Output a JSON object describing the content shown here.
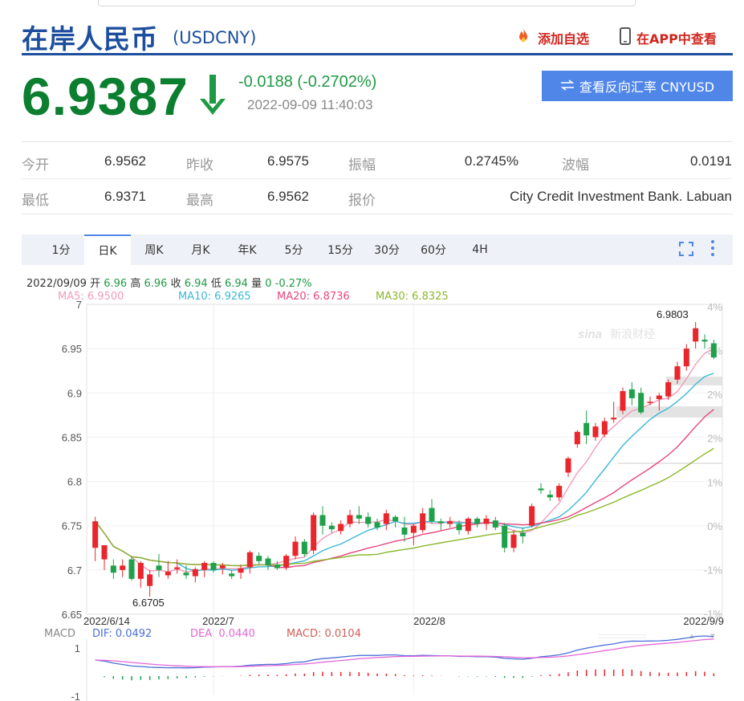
{
  "header": {
    "title": "在岸人民币",
    "code": "(USDCNY)",
    "add_watch": "添加自选",
    "view_app": "在APP中查看"
  },
  "quote": {
    "price": "6.9387",
    "change": "-0.0188 (-0.2702%)",
    "time": "2022-09-09 11:40:03",
    "reverse_button": "查看反向汇率 CNYUSD",
    "direction": "down"
  },
  "stats": [
    {
      "label": "今开",
      "value": "6.9562"
    },
    {
      "label": "昨收",
      "value": "6.9575"
    },
    {
      "label": "振幅",
      "value": "0.2745%"
    },
    {
      "label": "波幅",
      "value": "0.0191"
    },
    {
      "label": "最低",
      "value": "6.9371"
    },
    {
      "label": "最高",
      "value": "6.9562"
    },
    {
      "label": "报价",
      "value": "City Credit Investment Bank. Labuan"
    }
  ],
  "tabs": [
    "1分",
    "日K",
    "周K",
    "月K",
    "年K",
    "5分",
    "15分",
    "30分",
    "60分",
    "4H"
  ],
  "active_tab": "日K",
  "info_line": {
    "date": "2022/09/09",
    "open_label": "开",
    "open": "6.96",
    "high_label": "高",
    "high": "6.96",
    "close_label": "收",
    "close": "6.94",
    "low_label": "低",
    "low": "6.94",
    "volume_label": "量",
    "volume": "0",
    "change_pct": "-0.27%"
  },
  "ma_legend": [
    {
      "label": "MA5: 6.9500",
      "color": "#f29bb8"
    },
    {
      "label": "MA10: 6.9265",
      "color": "#3cb8d8"
    },
    {
      "label": "MA20: 6.8736",
      "color": "#e8467c"
    },
    {
      "label": "MA30: 6.8325",
      "color": "#8ab82e"
    }
  ],
  "macd_legend": {
    "title": "MACD",
    "dif": "DIF: 0.0492",
    "dea": "DEA: 0.0440",
    "macd": "MACD: 0.0104"
  },
  "colors": {
    "up": "#e8262b",
    "down": "#1ea14a",
    "brand": "#1d4e9e",
    "button": "#4f86e8"
  },
  "chart_data": {
    "type": "candlestick",
    "yticks": [
      "7",
      "6.95",
      "6.9",
      "6.85",
      "6.8",
      "6.75",
      "6.7",
      "6.65"
    ],
    "ylim": [
      6.65,
      7.0
    ],
    "right_ticks": [
      "4%",
      "3%",
      "2%",
      "2%",
      "1%",
      "0%",
      "-1%",
      "-1%"
    ],
    "xlabels": [
      "2022/6/14",
      "2022/7",
      "2022/8",
      "2022/9/9"
    ],
    "max_label": "6.9803",
    "min_label": "6.6705",
    "watermark": "sina 新浪财经",
    "macd_yticks": [
      "1",
      "-1"
    ],
    "candles": [
      [
        6.725,
        6.76,
        6.71,
        6.755
      ],
      [
        6.712,
        6.728,
        6.7,
        6.728
      ],
      [
        6.705,
        6.712,
        6.69,
        6.697
      ],
      [
        6.7,
        6.712,
        6.692,
        6.705
      ],
      [
        6.712,
        6.715,
        6.688,
        6.69
      ],
      [
        6.69,
        6.71,
        6.68,
        6.708
      ],
      [
        6.682,
        6.7,
        6.67,
        6.695
      ],
      [
        6.705,
        6.718,
        6.692,
        6.7
      ],
      [
        6.694,
        6.71,
        6.69,
        6.698
      ],
      [
        6.701,
        6.712,
        6.696,
        6.703
      ],
      [
        6.697,
        6.705,
        6.69,
        6.694
      ],
      [
        6.693,
        6.703,
        6.686,
        6.701
      ],
      [
        6.7,
        6.71,
        6.692,
        6.708
      ],
      [
        6.708,
        6.71,
        6.697,
        6.7
      ],
      [
        6.702,
        6.708,
        6.695,
        6.705
      ],
      [
        6.696,
        6.7,
        6.69,
        6.693
      ],
      [
        6.697,
        6.706,
        6.69,
        6.702
      ],
      [
        6.703,
        6.722,
        6.696,
        6.72
      ],
      [
        6.716,
        6.72,
        6.706,
        6.71
      ],
      [
        6.713,
        6.716,
        6.7,
        6.705
      ],
      [
        6.706,
        6.71,
        6.7,
        6.702
      ],
      [
        6.703,
        6.718,
        6.7,
        6.716
      ],
      [
        6.716,
        6.738,
        6.712,
        6.732
      ],
      [
        6.732,
        6.735,
        6.715,
        6.718
      ],
      [
        6.722,
        6.765,
        6.718,
        6.762
      ],
      [
        6.762,
        6.772,
        6.74,
        6.75
      ],
      [
        6.75,
        6.754,
        6.742,
        6.746
      ],
      [
        6.744,
        6.756,
        6.74,
        6.752
      ],
      [
        6.752,
        6.768,
        6.748,
        6.762
      ],
      [
        6.762,
        6.772,
        6.752,
        6.758
      ],
      [
        6.76,
        6.765,
        6.748,
        6.752
      ],
      [
        6.754,
        6.758,
        6.745,
        6.748
      ],
      [
        6.752,
        6.768,
        6.745,
        6.764
      ],
      [
        6.76,
        6.762,
        6.748,
        6.755
      ],
      [
        6.748,
        6.76,
        6.732,
        6.74
      ],
      [
        6.742,
        6.752,
        6.728,
        6.75
      ],
      [
        6.745,
        6.77,
        6.742,
        6.764
      ],
      [
        6.77,
        6.78,
        6.752,
        6.755
      ],
      [
        6.755,
        6.758,
        6.745,
        6.753
      ],
      [
        6.752,
        6.76,
        6.748,
        6.755
      ],
      [
        6.752,
        6.756,
        6.74,
        6.745
      ],
      [
        6.744,
        6.76,
        6.74,
        6.758
      ],
      [
        6.758,
        6.76,
        6.748,
        6.752
      ],
      [
        6.752,
        6.762,
        6.745,
        6.758
      ],
      [
        6.756,
        6.76,
        6.745,
        6.748
      ],
      [
        6.75,
        6.753,
        6.72,
        6.725
      ],
      [
        6.725,
        6.745,
        6.72,
        6.74
      ],
      [
        6.742,
        6.748,
        6.73,
        6.738
      ],
      [
        6.75,
        6.775,
        6.748,
        6.772
      ],
      [
        6.792,
        6.798,
        6.786,
        6.79
      ],
      [
        6.785,
        6.79,
        6.778,
        6.782
      ],
      [
        6.782,
        6.798,
        6.778,
        6.795
      ],
      [
        6.81,
        6.828,
        6.805,
        6.826
      ],
      [
        6.842,
        6.858,
        6.838,
        6.856
      ],
      [
        6.866,
        6.88,
        6.842,
        6.852
      ],
      [
        6.85,
        6.866,
        6.846,
        6.862
      ],
      [
        6.853,
        6.872,
        6.85,
        6.868
      ],
      [
        6.87,
        6.89,
        6.866,
        6.872
      ],
      [
        6.88,
        6.906,
        6.876,
        6.902
      ],
      [
        6.904,
        6.912,
        6.886,
        6.894
      ],
      [
        6.9,
        6.906,
        6.876,
        6.878
      ],
      [
        6.89,
        6.896,
        6.886,
        6.89
      ],
      [
        6.893,
        6.9,
        6.88,
        6.897
      ],
      [
        6.896,
        6.915,
        6.892,
        6.912
      ],
      [
        6.915,
        6.935,
        6.91,
        6.93
      ],
      [
        6.93,
        6.955,
        6.925,
        6.95
      ],
      [
        6.958,
        6.98,
        6.95,
        6.973
      ],
      [
        6.96,
        6.966,
        6.95,
        6.958
      ],
      [
        6.956,
        6.96,
        6.938,
        6.94
      ]
    ]
  }
}
